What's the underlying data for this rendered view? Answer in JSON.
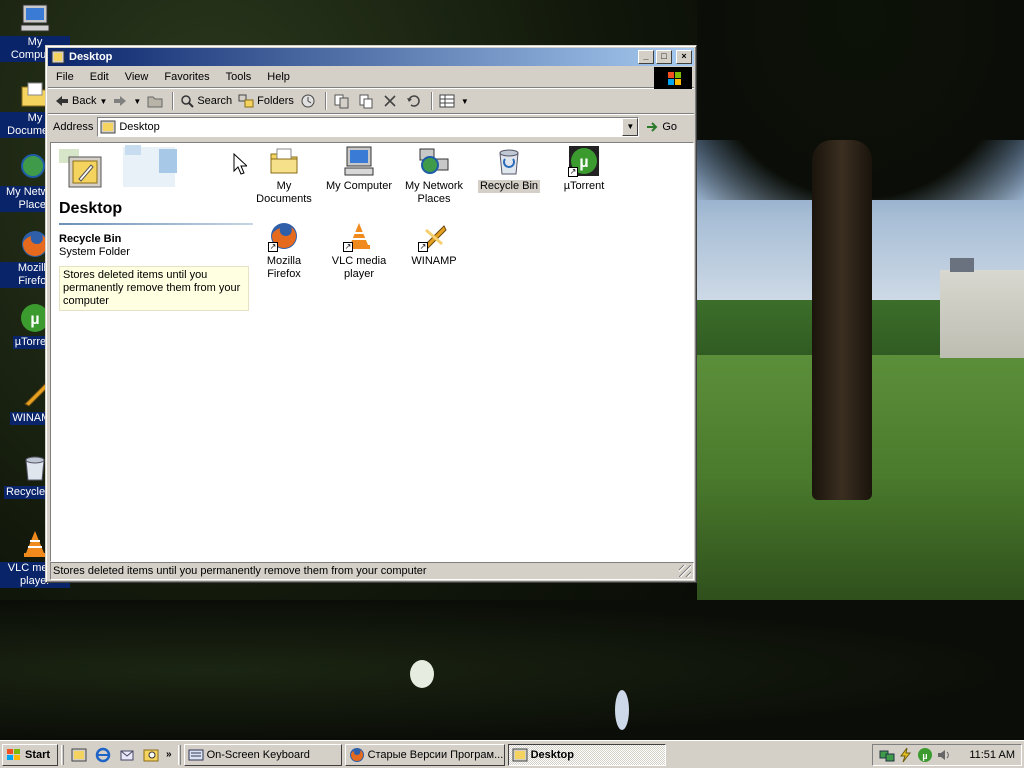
{
  "desktop": {
    "icons": [
      {
        "label": "My Computer",
        "name": "my-computer"
      },
      {
        "label": "My Documents",
        "name": "my-documents"
      },
      {
        "label": "My Network Places",
        "name": "my-network-places"
      },
      {
        "label": "Mozilla Firefox",
        "name": "mozilla-firefox"
      },
      {
        "label": "µTorrent",
        "name": "utorrent"
      },
      {
        "label": "WINAMP",
        "name": "winamp"
      },
      {
        "label": "Recycle Bin",
        "name": "recycle-bin"
      },
      {
        "label": "VLC media player",
        "name": "vlc"
      }
    ]
  },
  "window": {
    "title": "Desktop",
    "menu": [
      "File",
      "Edit",
      "View",
      "Favorites",
      "Tools",
      "Help"
    ],
    "toolbar": {
      "back": "Back",
      "search": "Search",
      "folders": "Folders"
    },
    "address": {
      "label": "Address",
      "value": "Desktop",
      "go": "Go"
    },
    "left_pane": {
      "title": "Desktop",
      "item_name": "Recycle Bin",
      "item_type": "System Folder",
      "description": "Stores deleted items until you permanently remove them from your computer"
    },
    "items": [
      {
        "label": "My Documents",
        "icon": "folder-documents-icon"
      },
      {
        "label": "My Computer",
        "icon": "computer-icon"
      },
      {
        "label": "My Network Places",
        "icon": "network-places-icon"
      },
      {
        "label": "Recycle Bin",
        "icon": "recycle-bin-icon",
        "selected": true
      },
      {
        "label": "µTorrent",
        "icon": "utorrent-icon",
        "shortcut": true
      },
      {
        "label": "Mozilla Firefox",
        "icon": "firefox-icon",
        "shortcut": true
      },
      {
        "label": "VLC media player",
        "icon": "vlc-icon",
        "shortcut": true
      },
      {
        "label": "WINAMP",
        "icon": "winamp-icon",
        "shortcut": true
      }
    ],
    "status": "Stores deleted items until you permanently remove them from your computer"
  },
  "taskbar": {
    "start": "Start",
    "quick_launch_more": "»",
    "tasks": [
      {
        "label": "On-Screen Keyboard",
        "active": false
      },
      {
        "label": "Старые Версии Програм...",
        "active": false
      },
      {
        "label": "Desktop",
        "active": true
      }
    ],
    "clock": "11:51 AM"
  },
  "colors": {
    "titlebar_start": "#0a246a",
    "titlebar_end": "#a6caf0",
    "face": "#d4d0c8",
    "selection": "#0a246a"
  }
}
